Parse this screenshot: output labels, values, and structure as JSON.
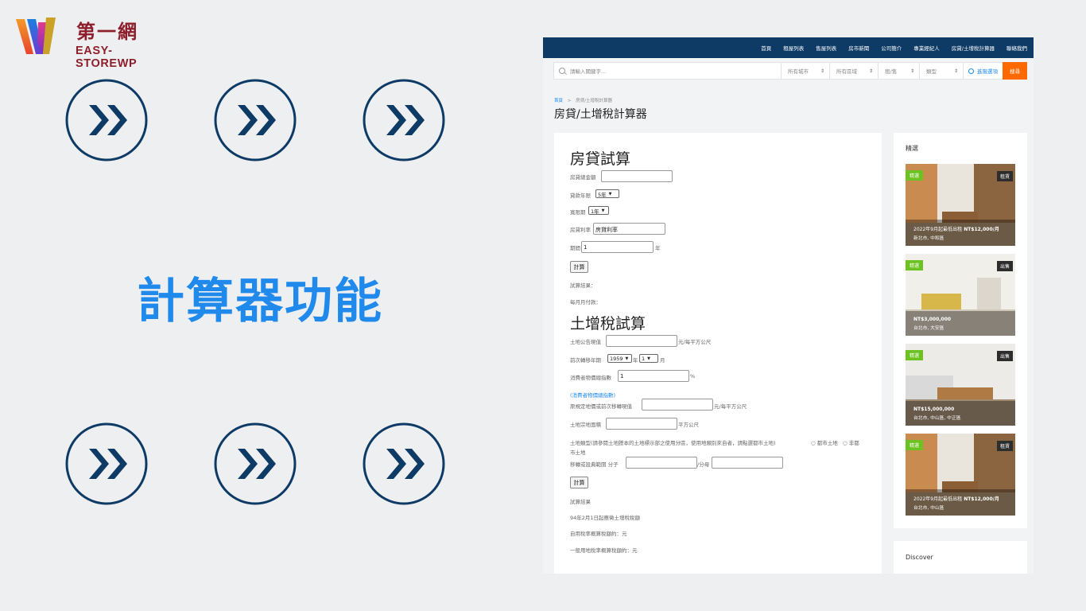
{
  "brand": {
    "cn_name": "第一網",
    "en_name": "EASY-STOREWP"
  },
  "promo": {
    "title": "計算器功能",
    "arrow_icon": "double-chevron-right-icon",
    "accent": "#1f8aec",
    "navy": "#0e3b66"
  },
  "site": {
    "nav": [
      "首頁",
      "租屋列表",
      "售屋列表",
      "房市新聞",
      "公司簡介",
      "專業經紀人",
      "房貸/土增稅計算器",
      "聯絡我們"
    ],
    "search": {
      "placeholder": "請輸入關鍵字...",
      "city": "所有城市",
      "district": "所有區域",
      "rent_sale": "租/售",
      "type": "類型",
      "advanced": "進階選項",
      "button": "搜尋"
    },
    "breadcrumb": {
      "home": "首頁",
      "sep": ">",
      "current": "房貸/土增稅計算器"
    },
    "page_title": "房貸/土增稅計算器",
    "mortgage": {
      "heading": "房貸試算",
      "amount_label": "房貸總金額",
      "years_label": "貸款年限",
      "years_value": "5年",
      "grace_label": "寬限期",
      "grace_value": "1年",
      "rate_label": "房貸利率",
      "rate_value": "房貸利率",
      "period_label": "期間",
      "period_value": "1",
      "period_unit": "年",
      "calc_button": "計算",
      "result_label": "試算結果：",
      "monthly_label": "每月月付款："
    },
    "land_tax": {
      "heading": "土增稅試算",
      "announced_label": "土地公告現值",
      "announced_unit": "元/每平方公尺",
      "prev_transfer_label": "前次轉移年期",
      "year_value": "1959",
      "year_unit": "年",
      "month_value": "1",
      "month_unit": "月",
      "cpi_label": "消費者物價總指數",
      "cpi_value": "1",
      "cpi_unit": "%",
      "cpi_link": "(消費者物價總指數)",
      "orig_label": "原規定地價或前次移轉現值",
      "orig_unit": "元/每平方公尺",
      "area_label": "土地宗地面積",
      "area_unit": "平方公尺",
      "type_label": "土地類型(請參閱土地謄本的土地標示部之使用分區，使用地類別來自者，請點選都市土地)",
      "type_opt1": "都市土地",
      "type_opt2": "非都",
      "type_cont": "市土地",
      "share_label": "移轉或設典範圍 分子",
      "share_sep": "/分母",
      "calc_button": "計算",
      "result_label": "試算結果",
      "note": "94年2月1日起應徵土增稅稅額",
      "self_use": "自用稅率概算稅額約：元",
      "general": "一般用地稅率概算稅額約：元"
    },
    "sidebar": {
      "featured_title": "精選",
      "discover_title": "Discover",
      "cards": [
        {
          "badge": "精選",
          "tag": "租賃",
          "price_pre": "2022年9月起最低出租",
          "price": "NT$12,000/月",
          "location": "新北市, 中和區"
        },
        {
          "badge": "精選",
          "tag": "出售",
          "price_pre": "",
          "price": "NT$3,000,000",
          "location": "台北市, 大安區"
        },
        {
          "badge": "精選",
          "tag": "出售",
          "price_pre": "",
          "price": "NT$15,000,000",
          "location": "台北市, 中山區, 中正區"
        },
        {
          "badge": "精選",
          "tag": "租賃",
          "price_pre": "2022年9月起最低出租",
          "price": "NT$12,000/月",
          "location": "台北市, 中山區"
        }
      ]
    }
  }
}
